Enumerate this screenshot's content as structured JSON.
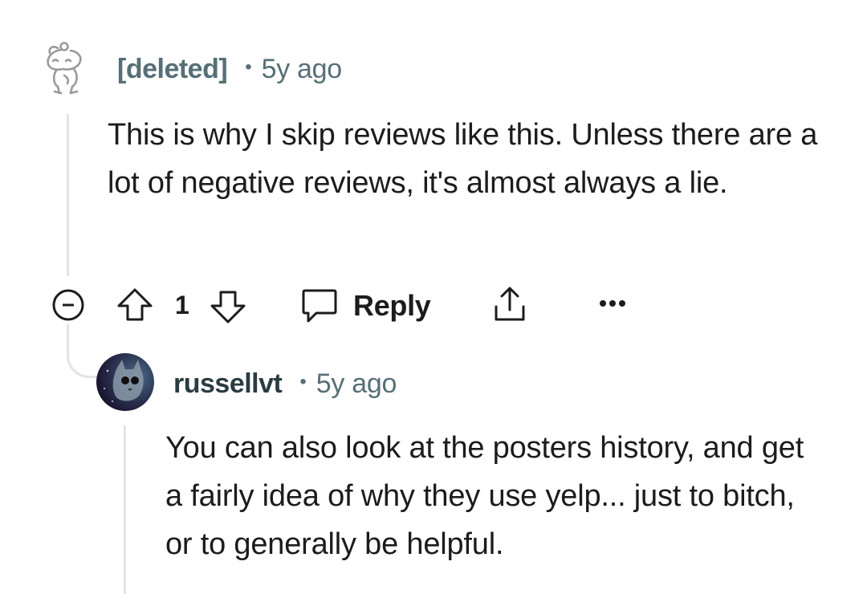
{
  "comment": {
    "author": "[deleted]",
    "separator": "•",
    "time": "5y ago",
    "body": "This is why I skip reviews like this. Unless there are a lot of negative reviews, it's almost always a lie.",
    "actions": {
      "collapse_icon": "minus-circle-icon",
      "upvote_icon": "arrow-up-icon",
      "score": "1",
      "downvote_icon": "arrow-down-icon",
      "reply_icon": "speech-bubble-icon",
      "reply_label": "Reply",
      "share_icon": "share-icon",
      "more_icon": "more-horizontal-icon"
    }
  },
  "reply": {
    "author": "russellvt",
    "separator": "•",
    "time": "5y ago",
    "body": "You can also look at the posters history, and get a fairly idea of why they use yelp... just to bitch, or to generally be helpful."
  }
}
